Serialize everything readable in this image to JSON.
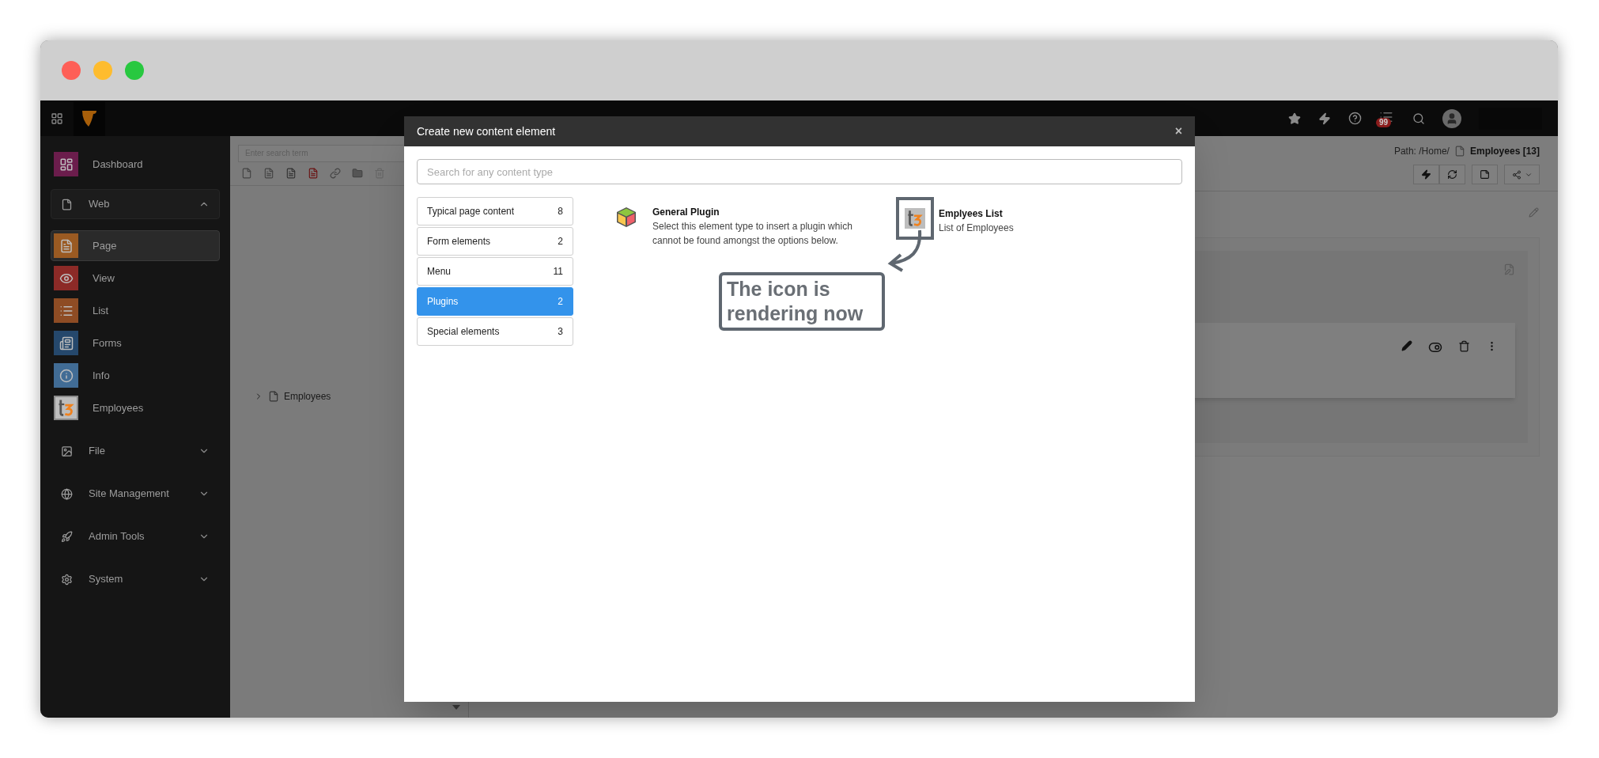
{
  "topbar": {
    "notification_count": "99"
  },
  "sidebar": {
    "items": [
      {
        "kind": "module",
        "label": "Dashboard",
        "color": "#6b1d4c",
        "selected": false
      },
      {
        "kind": "group",
        "label": "Web",
        "expanded": true,
        "children": [
          {
            "kind": "module",
            "label": "Page",
            "color": "#9a5a22",
            "selected": true
          },
          {
            "kind": "module",
            "label": "View",
            "color": "#8c2a27",
            "selected": false
          },
          {
            "kind": "module",
            "label": "List",
            "color": "#8e4c24",
            "selected": false
          },
          {
            "kind": "module",
            "label": "Forms",
            "color": "#25486c",
            "selected": false
          },
          {
            "kind": "module",
            "label": "Info",
            "color": "#416c95",
            "selected": false
          },
          {
            "kind": "module",
            "label": "Employees",
            "color": "#8a8a8a",
            "selected": false
          }
        ]
      },
      {
        "kind": "group",
        "label": "File",
        "expanded": false
      },
      {
        "kind": "group",
        "label": "Site Management",
        "expanded": false
      },
      {
        "kind": "group",
        "label": "Admin Tools",
        "expanded": false
      },
      {
        "kind": "group",
        "label": "System",
        "expanded": false
      }
    ]
  },
  "page_tree": {
    "search": {
      "placeholder": "Enter search term"
    },
    "items": [
      {
        "label": "Employees",
        "expanded": false
      }
    ]
  },
  "docheader": {
    "path": "Path: /Home/",
    "page_title": "Employees [13]"
  },
  "modal": {
    "title": "Create new content element",
    "close": "×",
    "search": {
      "placeholder": "Search for any content type"
    },
    "categories": [
      {
        "label": "Typical page content",
        "count": "8",
        "selected": false
      },
      {
        "label": "Form elements",
        "count": "2",
        "selected": false
      },
      {
        "label": "Menu",
        "count": "11",
        "selected": false
      },
      {
        "label": "Plugins",
        "count": "2",
        "selected": true
      },
      {
        "label": "Special elements",
        "count": "3",
        "selected": false
      }
    ],
    "items": [
      {
        "kind": "plugin",
        "title": "General Plugin",
        "description": "Select this element type to insert a plugin which cannot be found amongst the options below."
      },
      {
        "kind": "extension",
        "title": "Emplyees List",
        "description": "List of Employees"
      }
    ]
  },
  "annotation": {
    "text": "The icon is rendering now"
  }
}
